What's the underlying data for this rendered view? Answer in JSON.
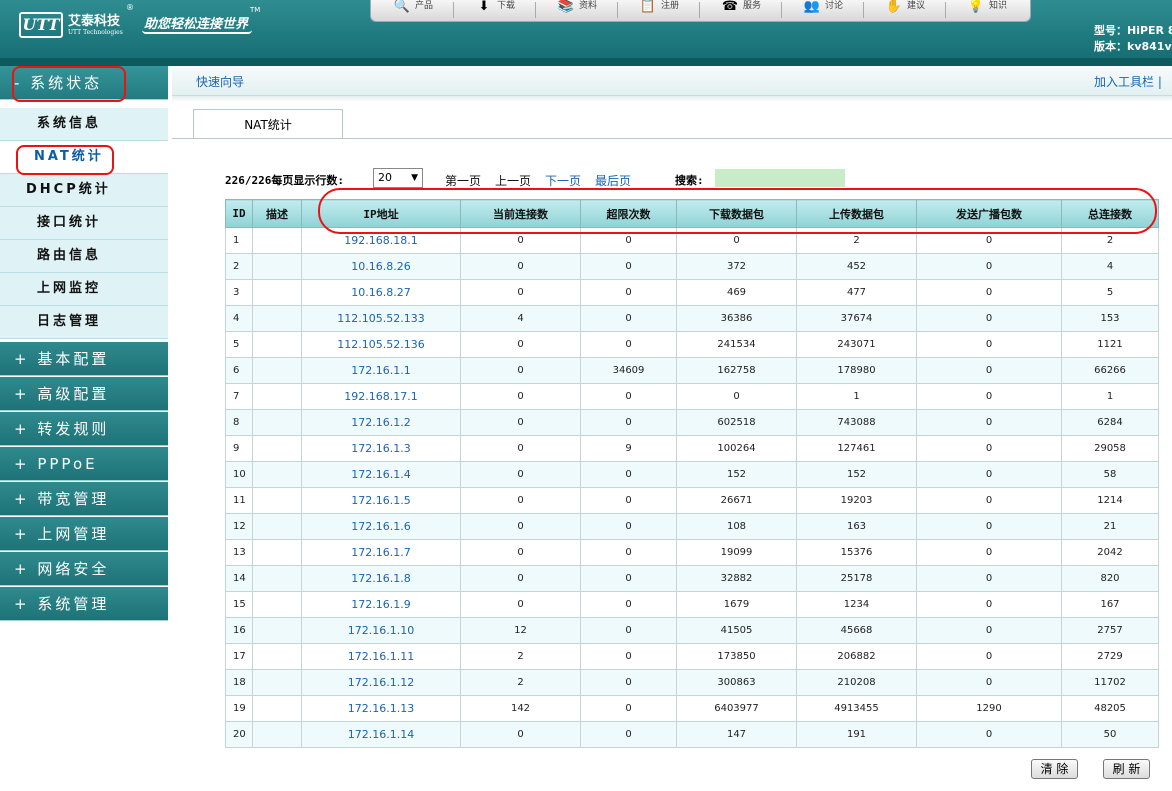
{
  "header": {
    "logo_text": "UTT",
    "company_cn": "艾泰科技",
    "company_en": "UTT Technologies",
    "reg": "®",
    "slogan": "助您轻松连接世界",
    "tm": "TM",
    "model": "型号：HiPER 8",
    "version": "版本：kv841v",
    "nav": [
      {
        "icon": "search-icon",
        "glyph": "🔍",
        "label": "产品"
      },
      {
        "icon": "download-icon",
        "glyph": "⬇",
        "label": "下载"
      },
      {
        "icon": "docs-icon",
        "glyph": "📚",
        "label": "资料"
      },
      {
        "icon": "register-icon",
        "glyph": "📋",
        "label": "注册"
      },
      {
        "icon": "phone-icon",
        "glyph": "☎",
        "label": "服务"
      },
      {
        "icon": "forum-icon",
        "glyph": "👥",
        "label": "讨论"
      },
      {
        "icon": "suggest-icon",
        "glyph": "✋",
        "label": "建议"
      },
      {
        "icon": "knowledge-icon",
        "glyph": "💡",
        "label": "知识"
      }
    ]
  },
  "sidebar": {
    "sections": [
      {
        "label": "- 系统状态",
        "open": true
      },
      {
        "label": "+ 基本配置"
      },
      {
        "label": "+ 高级配置"
      },
      {
        "label": "+ 转发规则"
      },
      {
        "label": "+ PPPoE"
      },
      {
        "label": "+ 带宽管理"
      },
      {
        "label": "+ 上网管理"
      },
      {
        "label": "+ 网络安全"
      },
      {
        "label": "+ 系统管理"
      }
    ],
    "sub_items": [
      "系统信息",
      "NAT统计",
      "DHCP统计",
      "接口统计",
      "路由信息",
      "上网监控",
      "日志管理"
    ],
    "active_sub": "NAT统计"
  },
  "content": {
    "quick_guide": "快速向导",
    "add_toolbar": "加入工具栏 |",
    "tab": "NAT统计",
    "pager": {
      "rows_info": "226/226每页显示行数:",
      "rows_value": "20",
      "first": "第一页",
      "prev": "上一页",
      "next": "下一页",
      "last": "最后页",
      "search_label": "搜索:",
      "search_value": ""
    },
    "columns": [
      "ID",
      "描述",
      "IP地址",
      "当前连接数",
      "超限次数",
      "下载数据包",
      "上传数据包",
      "发送广播包数",
      "总连接数"
    ],
    "rows": [
      [
        "1",
        "",
        "192.168.18.1",
        "0",
        "0",
        "0",
        "2",
        "0",
        "2"
      ],
      [
        "2",
        "",
        "10.16.8.26",
        "0",
        "0",
        "372",
        "452",
        "0",
        "4"
      ],
      [
        "3",
        "",
        "10.16.8.27",
        "0",
        "0",
        "469",
        "477",
        "0",
        "5"
      ],
      [
        "4",
        "",
        "112.105.52.133",
        "4",
        "0",
        "36386",
        "37674",
        "0",
        "153"
      ],
      [
        "5",
        "",
        "112.105.52.136",
        "0",
        "0",
        "241534",
        "243071",
        "0",
        "1121"
      ],
      [
        "6",
        "",
        "172.16.1.1",
        "0",
        "34609",
        "162758",
        "178980",
        "0",
        "66266"
      ],
      [
        "7",
        "",
        "192.168.17.1",
        "0",
        "0",
        "0",
        "1",
        "0",
        "1"
      ],
      [
        "8",
        "",
        "172.16.1.2",
        "0",
        "0",
        "602518",
        "743088",
        "0",
        "6284"
      ],
      [
        "9",
        "",
        "172.16.1.3",
        "0",
        "9",
        "100264",
        "127461",
        "0",
        "29058"
      ],
      [
        "10",
        "",
        "172.16.1.4",
        "0",
        "0",
        "152",
        "152",
        "0",
        "58"
      ],
      [
        "11",
        "",
        "172.16.1.5",
        "0",
        "0",
        "26671",
        "19203",
        "0",
        "1214"
      ],
      [
        "12",
        "",
        "172.16.1.6",
        "0",
        "0",
        "108",
        "163",
        "0",
        "21"
      ],
      [
        "13",
        "",
        "172.16.1.7",
        "0",
        "0",
        "19099",
        "15376",
        "0",
        "2042"
      ],
      [
        "14",
        "",
        "172.16.1.8",
        "0",
        "0",
        "32882",
        "25178",
        "0",
        "820"
      ],
      [
        "15",
        "",
        "172.16.1.9",
        "0",
        "0",
        "1679",
        "1234",
        "0",
        "167"
      ],
      [
        "16",
        "",
        "172.16.1.10",
        "12",
        "0",
        "41505",
        "45668",
        "0",
        "2757"
      ],
      [
        "17",
        "",
        "172.16.1.11",
        "2",
        "0",
        "173850",
        "206882",
        "0",
        "2729"
      ],
      [
        "18",
        "",
        "172.16.1.12",
        "2",
        "0",
        "300863",
        "210208",
        "0",
        "11702"
      ],
      [
        "19",
        "",
        "172.16.1.13",
        "142",
        "0",
        "6403977",
        "4913455",
        "1290",
        "48205"
      ],
      [
        "20",
        "",
        "172.16.1.14",
        "0",
        "0",
        "147",
        "191",
        "0",
        "50"
      ]
    ],
    "buttons": {
      "clear": "清 除",
      "refresh": "刷 新"
    }
  },
  "colors": {
    "brand_teal": "#1f7a7f",
    "link_blue": "#1a64b0",
    "annotation_red": "#e11111"
  }
}
